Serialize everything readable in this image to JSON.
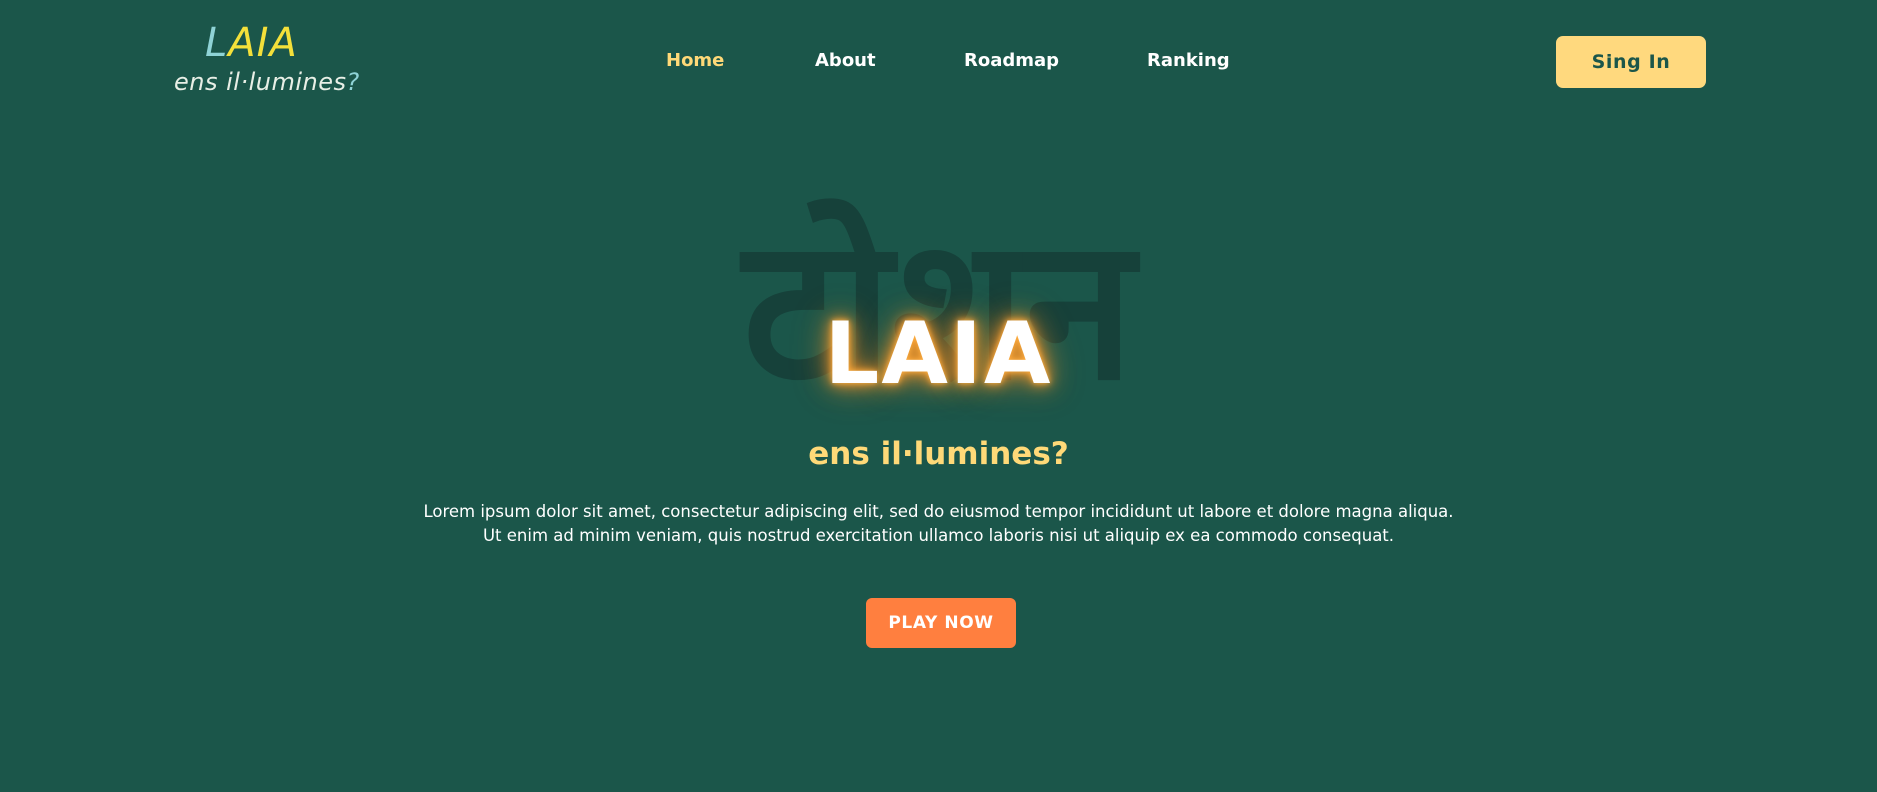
{
  "logo": {
    "mark_first": "L",
    "mark_rest": "AIA",
    "tagline": "ens il·lumines",
    "tagline_q": "?"
  },
  "nav": {
    "items": [
      {
        "label": "Home",
        "active": true
      },
      {
        "label": "About",
        "active": false
      },
      {
        "label": "Roadmap",
        "active": false
      },
      {
        "label": "Ranking",
        "active": false
      }
    ]
  },
  "header": {
    "signin_label": "Sing In"
  },
  "hero": {
    "background_glyph": "टोशन",
    "title": "LAIA",
    "subtitle": "ens il·lumines?",
    "text_line1": "Lorem ipsum dolor sit amet, consectetur adipiscing elit, sed do eiusmod tempor incididunt ut labore et dolore magna aliqua.",
    "text_line2": "Ut enim ad minim veniam, quis nostrud exercitation ullamco laboris nisi ut aliquip ex ea commodo consequat.",
    "play_label": "PLAY NOW"
  },
  "colors": {
    "background": "#1b564a",
    "accent_yellow": "#ffd978",
    "accent_orange": "#ff7f3f",
    "logo_teal": "#8fd3d6",
    "logo_yellow": "#f4e03a"
  }
}
